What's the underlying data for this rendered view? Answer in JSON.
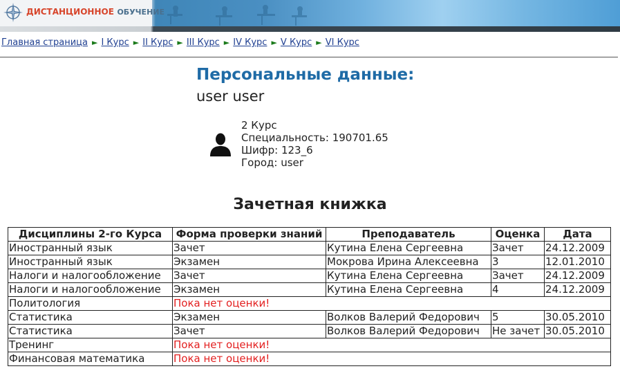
{
  "header": {
    "logo_word1": "Дистанционное",
    "logo_word2": "обучение"
  },
  "nav": [
    {
      "label": "Главная страница"
    },
    {
      "label": "I Курс"
    },
    {
      "label": "II Курс"
    },
    {
      "label": "III Курс"
    },
    {
      "label": "IV Курс"
    },
    {
      "label": "V Курс"
    },
    {
      "label": "VI Курс"
    }
  ],
  "personal": {
    "title": "Персональные данные:",
    "name": "user user",
    "course": "2 Курс",
    "specialty": "Специальность: 190701.65",
    "code": "Шифр: 123_6",
    "city": "Город: user",
    "avatar_icon": "person-silhouette-icon"
  },
  "grades": {
    "title": "Зачетная книжка",
    "headers": [
      "Дисциплины 2-го Курса",
      "Форма проверки знаний",
      "Преподаватель",
      "Оценка",
      "Дата"
    ],
    "rows": [
      {
        "discipline": "Иностранный язык",
        "form": "Зачет",
        "teacher": "Кутина Елена Сергеевна",
        "grade": "Зачет",
        "date": "24.12.2009"
      },
      {
        "discipline": "Иностранный язык",
        "form": "Экзамен",
        "teacher": "Мокрова Ирина Алексеевна",
        "grade": "3",
        "date": "12.01.2010"
      },
      {
        "discipline": "Налоги и налогообложение",
        "form": "Зачет",
        "teacher": "Кутина Елена Сергеевна",
        "grade": "Зачет",
        "date": "24.12.2009"
      },
      {
        "discipline": "Налоги и налогообложение",
        "form": "Экзамен",
        "teacher": "Кутина Елена Сергеевна",
        "grade": "4",
        "date": "24.12.2009"
      },
      {
        "discipline": "Политология",
        "pending": "Пока нет оценки!"
      },
      {
        "discipline": "Статистика",
        "form": "Экзамен",
        "teacher": "Волков Валерий Федорович",
        "grade": "5",
        "date": "30.05.2010"
      },
      {
        "discipline": "Статистика",
        "form": "Зачет",
        "teacher": "Волков Валерий Федорович",
        "grade": "Не зачет",
        "date": "30.05.2010"
      },
      {
        "discipline": "Тренинг",
        "pending": "Пока нет оценки!"
      },
      {
        "discipline": "Финансовая математика",
        "pending": "Пока нет оценки!"
      }
    ]
  },
  "colors": {
    "title_blue": "#1f6ba6",
    "link_blue": "#1f3f91",
    "pending_red": "#e32020",
    "arrow_green": "#1a7a1a"
  }
}
